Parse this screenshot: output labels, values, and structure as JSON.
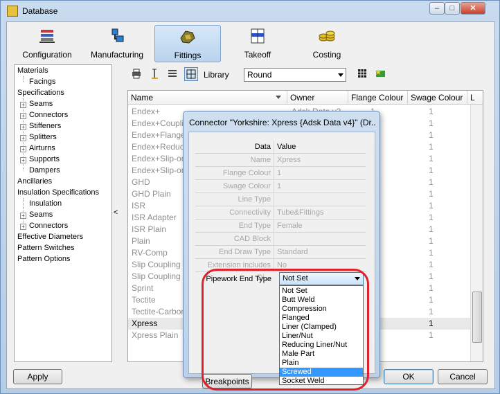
{
  "window": {
    "title": "Database"
  },
  "tabs": [
    {
      "label": "Configuration",
      "icon": "configuration-icon"
    },
    {
      "label": "Manufacturing",
      "icon": "manufacturing-icon"
    },
    {
      "label": "Fittings",
      "icon": "fittings-icon",
      "selected": true
    },
    {
      "label": "Takeoff",
      "icon": "takeoff-icon"
    },
    {
      "label": "Costing",
      "icon": "costing-icon"
    }
  ],
  "tree": {
    "materials": "Materials",
    "facings": "Facings",
    "specifications": "Specifications",
    "seams": "Seams",
    "connectors": "Connectors",
    "stiffeners": "Stiffeners",
    "splitters": "Splitters",
    "airturns": "Airturns",
    "supports": "Supports",
    "dampers": "Dampers",
    "ancillaries": "Ancillaries",
    "insulation_specs": "Insulation Specifications",
    "insulation": "Insulation",
    "ins_seams": "Seams",
    "ins_connectors": "Connectors",
    "effective_diameters": "Effective Diameters",
    "pattern_switches": "Pattern Switches",
    "pattern_options": "Pattern Options"
  },
  "splitter_glyph": "<",
  "toolbar": {
    "library_label": "Library",
    "library_value": "Round"
  },
  "grid": {
    "headers": {
      "name": "Name",
      "owner": "Owner",
      "flange": "Flange Colour",
      "swage": "Swage Colour",
      "extra": "L"
    },
    "rows": [
      {
        "name": "Endex+",
        "owner": "Adsk Data v3",
        "flange": "1",
        "swage": "1"
      },
      {
        "name": "Endex+Coupling",
        "owner": "",
        "flange": "",
        "swage": "1"
      },
      {
        "name": "Endex+Flange",
        "owner": "",
        "flange": "",
        "swage": "1"
      },
      {
        "name": "Endex+Reducer",
        "owner": "",
        "flange": "",
        "swage": "1"
      },
      {
        "name": "Endex+Slip-on F",
        "owner": "",
        "flange": "",
        "swage": "1"
      },
      {
        "name": "Endex+Slip-on F",
        "owner": "",
        "flange": "",
        "swage": "1"
      },
      {
        "name": "GHD",
        "owner": "",
        "flange": "",
        "swage": "1"
      },
      {
        "name": "GHD  Plain",
        "owner": "",
        "flange": "",
        "swage": "1"
      },
      {
        "name": "ISR",
        "owner": "",
        "flange": "",
        "swage": "1"
      },
      {
        "name": "ISR Adapter",
        "owner": "",
        "flange": "",
        "swage": "1"
      },
      {
        "name": "ISR Plain",
        "owner": "",
        "flange": "",
        "swage": "1"
      },
      {
        "name": "Plain",
        "owner": "",
        "flange": "",
        "swage": "1"
      },
      {
        "name": "RV-Comp",
        "owner": "",
        "flange": "",
        "swage": "1"
      },
      {
        "name": "Slip Coupling",
        "owner": "",
        "flange": "",
        "swage": "1"
      },
      {
        "name": "Slip Coupling SS",
        "owner": "",
        "flange": "",
        "swage": "1"
      },
      {
        "name": "Sprint",
        "owner": "",
        "flange": "",
        "swage": "1"
      },
      {
        "name": "Tectite",
        "owner": "",
        "flange": "",
        "swage": "1"
      },
      {
        "name": "Tectite-Carbon",
        "owner": "",
        "flange": "",
        "swage": "1"
      },
      {
        "name": "Xpress",
        "owner": "",
        "flange": "",
        "swage": "1",
        "selected": true
      },
      {
        "name": "Xpress Plain",
        "owner": "",
        "flange": "",
        "swage": "1"
      }
    ]
  },
  "buttons": {
    "apply": "Apply",
    "ok": "OK",
    "cancel": "Cancel"
  },
  "dialog": {
    "title": "Connector \"Yorkshire: Xpress {Adsk Data v4}\" (Dr...",
    "header_data": "Data",
    "header_value": "Value",
    "props": [
      {
        "label": "Name",
        "value": "Xpress"
      },
      {
        "label": "Flange Colour",
        "value": "1"
      },
      {
        "label": "Swage Colour",
        "value": "1"
      },
      {
        "label": "Line Type",
        "value": ""
      },
      {
        "label": "Connectivity",
        "value": "Tube&Fittings"
      },
      {
        "label": "End Type",
        "value": "Female"
      },
      {
        "label": "CAD Block",
        "value": ""
      },
      {
        "label": "End Draw Type",
        "value": "Standard"
      },
      {
        "label": "Extension includes Di...",
        "value": "No"
      }
    ],
    "active_prop": {
      "label": "Pipework End Type",
      "value": "Not Set"
    },
    "breakpoints_button": "Breakpoints",
    "options": [
      "Not Set",
      "Butt Weld",
      "Compression",
      "Flanged",
      "Liner (Clamped)",
      "Liner/Nut",
      "Reducing Liner/Nut",
      "Male Part",
      "Plain",
      "Screwed",
      "Socket Weld"
    ],
    "highlighted_option": "Screwed"
  },
  "colors": {
    "highlight": "#3399ff",
    "annotation": "#e0202a",
    "selected_tab": "#b9d3ee"
  }
}
